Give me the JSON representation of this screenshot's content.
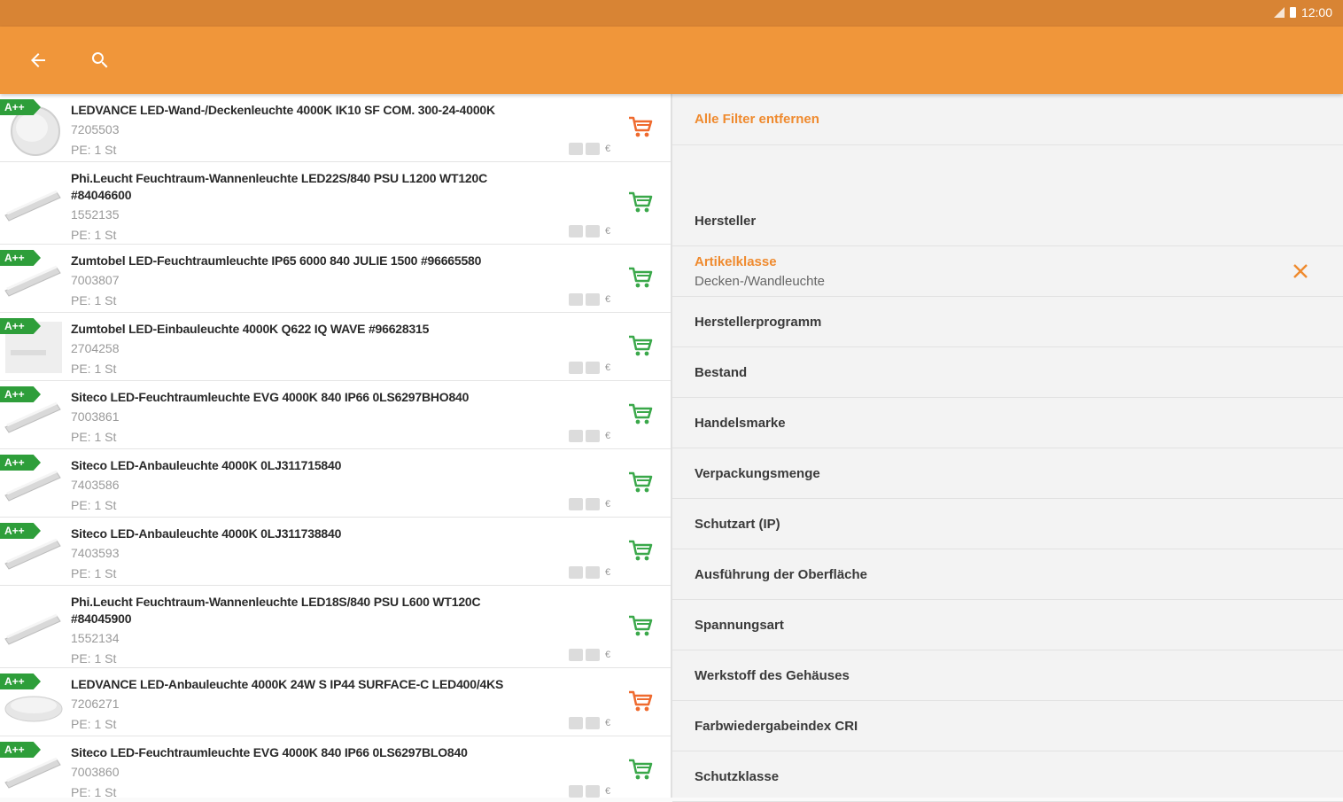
{
  "status": {
    "time": "12:00"
  },
  "colors": {
    "status_bar": "#d88434",
    "app_bar": "#f0963a",
    "accent": "#ef8a2e",
    "badge_green": "#2e9e3a",
    "cart_green": "#3aa84a",
    "cart_orange": "#ef6a2e"
  },
  "app_bar": {
    "back_icon": "arrow-left-icon",
    "search_icon": "search-icon"
  },
  "products": [
    {
      "badge": "A++",
      "title_lines": [
        "LEDVANCE LED-Wand-/Deckenleuchte 4000K IK10 SF COM. 300-24-4000K"
      ],
      "number": "7205503",
      "pe": "PE: 1 St",
      "cart_color": "orange",
      "currency": "€"
    },
    {
      "badge": "",
      "title_lines": [
        "Phi.Leucht Feuchtraum-Wannenleuchte LED22S/840 PSU L1200 WT120C",
        "#84046600"
      ],
      "number": "1552135",
      "pe": "PE: 1 St",
      "cart_color": "green",
      "currency": "€"
    },
    {
      "badge": "A++",
      "title_lines": [
        "Zumtobel LED-Feuchtraumleuchte IP65 6000 840 JULIE 1500 #96665580"
      ],
      "number": "7003807",
      "pe": "PE: 1 St",
      "cart_color": "green",
      "currency": "€"
    },
    {
      "badge": "A++",
      "title_lines": [
        "Zumtobel LED-Einbauleuchte 4000K Q622 IQ WAVE #96628315"
      ],
      "number": "2704258",
      "pe": "PE: 1 St",
      "cart_color": "green",
      "currency": "€"
    },
    {
      "badge": "A++",
      "title_lines": [
        "Siteco LED-Feuchtraumleuchte EVG 4000K 840 IP66 0LS6297BHO840"
      ],
      "number": "7003861",
      "pe": "PE: 1 St",
      "cart_color": "green",
      "currency": "€"
    },
    {
      "badge": "A++",
      "title_lines": [
        "Siteco LED-Anbauleuchte 4000K 0LJ311715840"
      ],
      "number": "7403586",
      "pe": "PE: 1 St",
      "cart_color": "green",
      "currency": "€"
    },
    {
      "badge": "A++",
      "title_lines": [
        "Siteco LED-Anbauleuchte 4000K 0LJ311738840"
      ],
      "number": "7403593",
      "pe": "PE: 1 St",
      "cart_color": "green",
      "currency": "€"
    },
    {
      "badge": "",
      "title_lines": [
        "Phi.Leucht Feuchtraum-Wannenleuchte LED18S/840 PSU L600 WT120C",
        "#84045900"
      ],
      "number": "1552134",
      "pe": "PE: 1 St",
      "cart_color": "green",
      "currency": "€"
    },
    {
      "badge": "A++",
      "title_lines": [
        "LEDVANCE LED-Anbauleuchte 4000K 24W S IP44 SURFACE-C LED400/4KS"
      ],
      "number": "7206271",
      "pe": "PE: 1 St",
      "cart_color": "orange",
      "currency": "€"
    },
    {
      "badge": "A++",
      "title_lines": [
        "Siteco LED-Feuchtraumleuchte EVG 4000K 840 IP66 0LS6297BLO840"
      ],
      "number": "7003860",
      "pe": "PE: 1 St",
      "cart_color": "green",
      "currency": "€"
    }
  ],
  "filters": {
    "clear_all": "Alle Filter entfernen",
    "items": [
      {
        "label": "Hersteller",
        "value": "",
        "active": false
      },
      {
        "label": "Artikelklasse",
        "value": "Decken-/Wandleuchte",
        "active": true
      },
      {
        "label": "Herstellerprogramm",
        "value": "",
        "active": false
      },
      {
        "label": "Bestand",
        "value": "",
        "active": false
      },
      {
        "label": "Handelsmarke",
        "value": "",
        "active": false
      },
      {
        "label": "Verpackungsmenge",
        "value": "",
        "active": false
      },
      {
        "label": "Schutzart (IP)",
        "value": "",
        "active": false
      },
      {
        "label": "Ausführung der Oberfläche",
        "value": "",
        "active": false
      },
      {
        "label": "Spannungsart",
        "value": "",
        "active": false
      },
      {
        "label": "Werkstoff des Gehäuses",
        "value": "",
        "active": false
      },
      {
        "label": "Farbwiedergabeindex CRI",
        "value": "",
        "active": false
      },
      {
        "label": "Schutzklasse",
        "value": "",
        "active": false
      }
    ]
  }
}
